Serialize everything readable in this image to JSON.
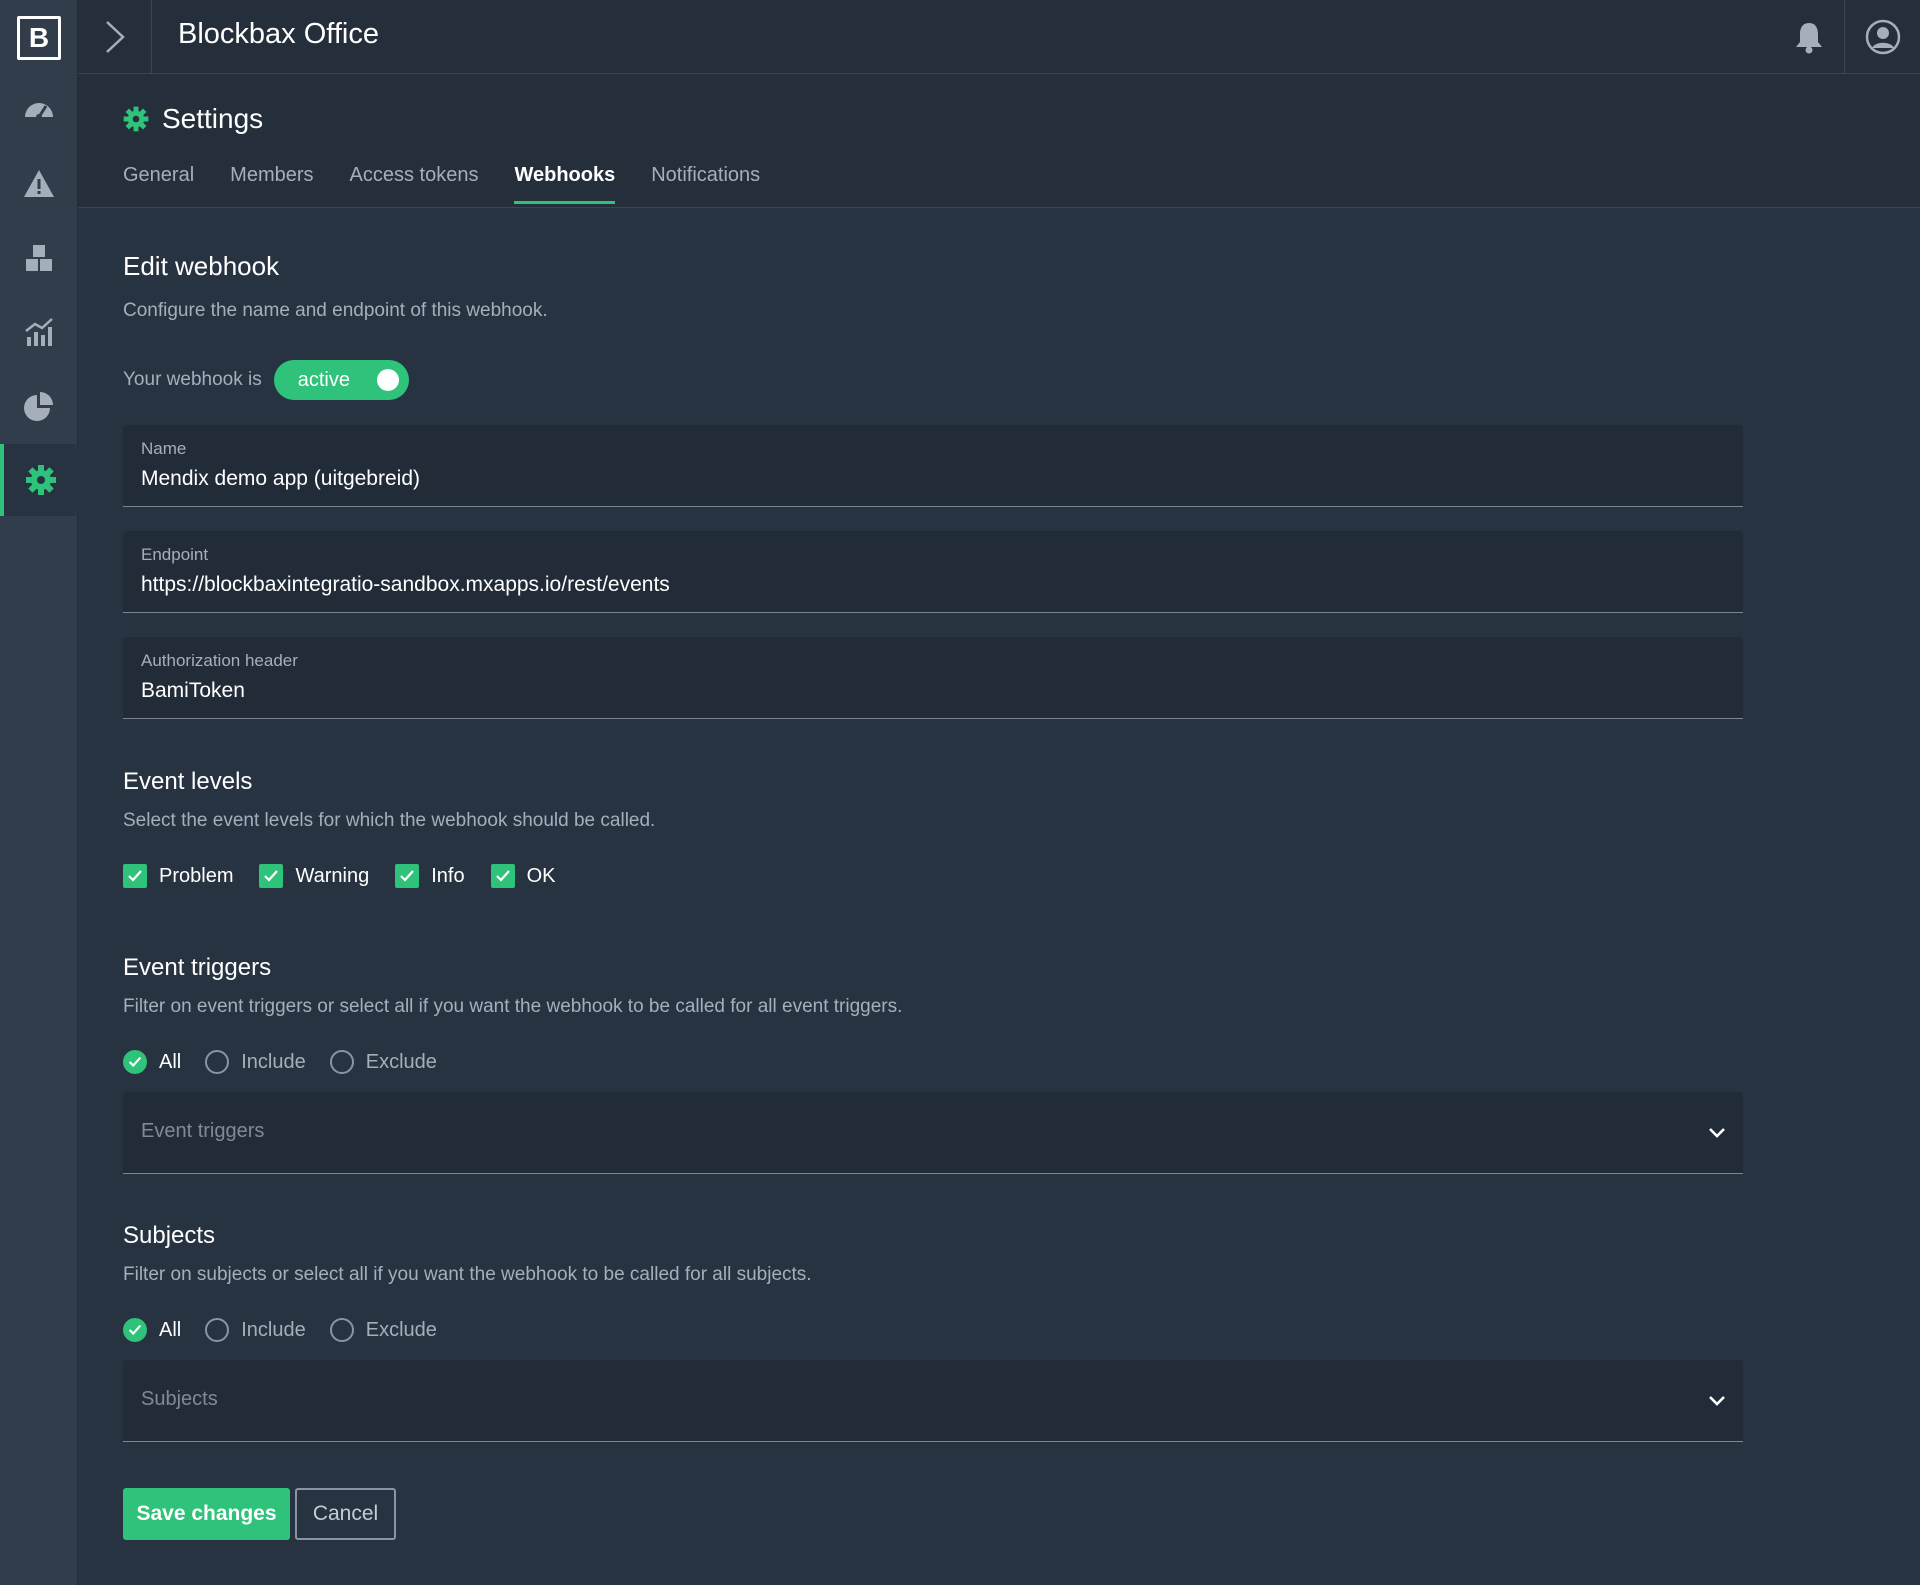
{
  "app": {
    "logo_letter": "B",
    "title": "Blockbax Office"
  },
  "sidebar": {
    "items": [
      {
        "icon": "speedometer-icon"
      },
      {
        "icon": "warning-icon"
      },
      {
        "icon": "blocks-icon"
      },
      {
        "icon": "analytics-chart-icon"
      },
      {
        "icon": "pie-chart-icon"
      },
      {
        "icon": "gear-icon",
        "active": true
      }
    ]
  },
  "header": {
    "title": "Settings",
    "tabs": [
      {
        "label": "General"
      },
      {
        "label": "Members"
      },
      {
        "label": "Access tokens"
      },
      {
        "label": "Webhooks",
        "active": true
      },
      {
        "label": "Notifications"
      }
    ]
  },
  "form": {
    "title": "Edit webhook",
    "description": "Configure the name and endpoint of this webhook.",
    "status_prefix": "Your webhook is",
    "status_value": "active",
    "fields": [
      {
        "label": "Name",
        "value": "Mendix demo app (uitgebreid)"
      },
      {
        "label": "Endpoint",
        "value": "https://blockbaxintegratio-sandbox.mxapps.io/rest/events"
      },
      {
        "label": "Authorization header",
        "value": "BamiToken"
      }
    ],
    "event_levels": {
      "title": "Event levels",
      "description": "Select the event levels for which the webhook should be called.",
      "options": [
        {
          "label": "Problem",
          "checked": true
        },
        {
          "label": "Warning",
          "checked": true
        },
        {
          "label": "Info",
          "checked": true
        },
        {
          "label": "OK",
          "checked": true
        }
      ]
    },
    "event_triggers": {
      "title": "Event triggers",
      "description": "Filter on event triggers or select all if you want the webhook to be called for all event triggers.",
      "options": [
        "All",
        "Include",
        "Exclude"
      ],
      "selected": "All",
      "placeholder": "Event triggers"
    },
    "subjects": {
      "title": "Subjects",
      "description": "Filter on subjects or select all if you want the webhook to be called for all subjects.",
      "options": [
        "All",
        "Include",
        "Exclude"
      ],
      "selected": "All",
      "placeholder": "Subjects"
    },
    "save_label": "Save changes",
    "cancel_label": "Cancel"
  },
  "colors": {
    "accent": "#2fc27a",
    "background": "#283342",
    "sidebar": "#323d4b"
  }
}
